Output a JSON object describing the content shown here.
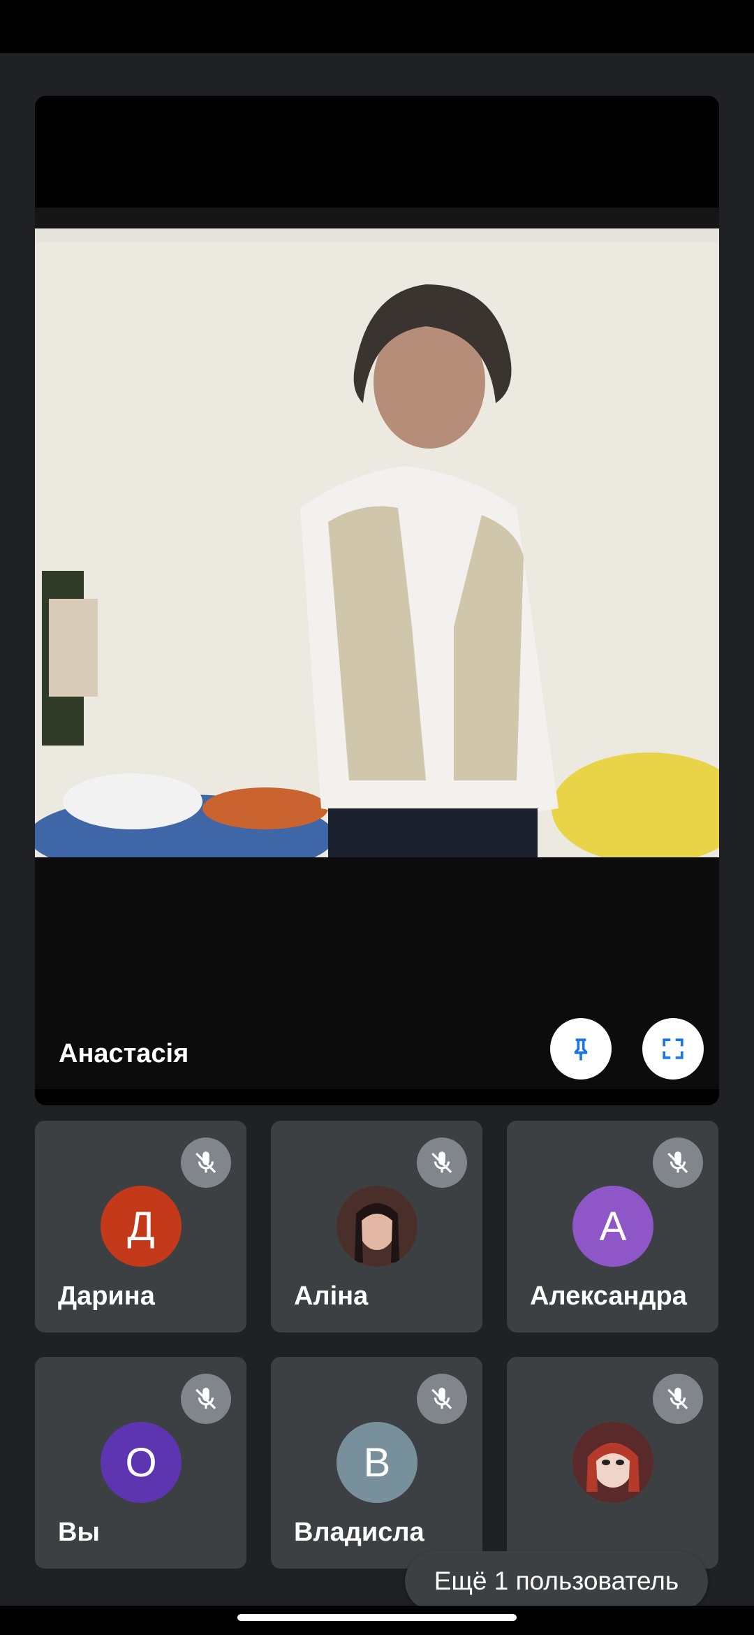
{
  "main": {
    "speaker_name": "Анастасія",
    "pin_icon": "pin-icon",
    "fullscreen_icon": "fullscreen-icon"
  },
  "participants": [
    {
      "name": "Дарина",
      "initial": "Д",
      "color": "#c5391b",
      "muted": true
    },
    {
      "name": "Аліна",
      "initial": "",
      "color": "#6d4c41",
      "muted": true,
      "photo": true
    },
    {
      "name": "Александра",
      "initial": "А",
      "color": "#8e56c6",
      "muted": true
    },
    {
      "name": "Вы",
      "initial": "О",
      "color": "#5e35b1",
      "muted": true
    },
    {
      "name": "Владисла",
      "initial": "В",
      "color": "#78909c",
      "muted": true
    },
    {
      "name": "",
      "initial": "",
      "color": "#7b3b3b",
      "muted": true,
      "photo": true
    }
  ],
  "more": {
    "label": "Ещё 1 пользователь"
  }
}
